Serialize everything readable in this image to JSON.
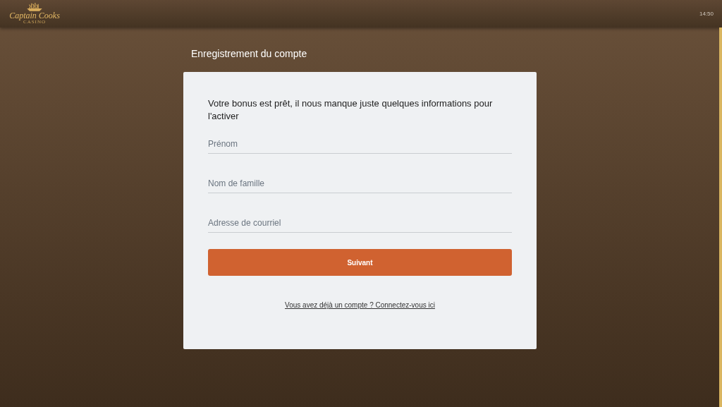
{
  "header": {
    "logo": {
      "name": "Captain Cooks",
      "tagline": "CASINO"
    },
    "time": "14:50"
  },
  "page_title": "Enregistrement du compte",
  "form": {
    "intro": "Votre bonus est prêt, il nous manque juste quelques informations pour l'activer",
    "fields": [
      {
        "placeholder": "Prénom"
      },
      {
        "placeholder": "Nom de famille"
      },
      {
        "placeholder": "Adresse de courriel"
      }
    ],
    "submit": "Suivant",
    "login_link": "Vous avez déjà un compte ? Connectez-vous ici"
  }
}
